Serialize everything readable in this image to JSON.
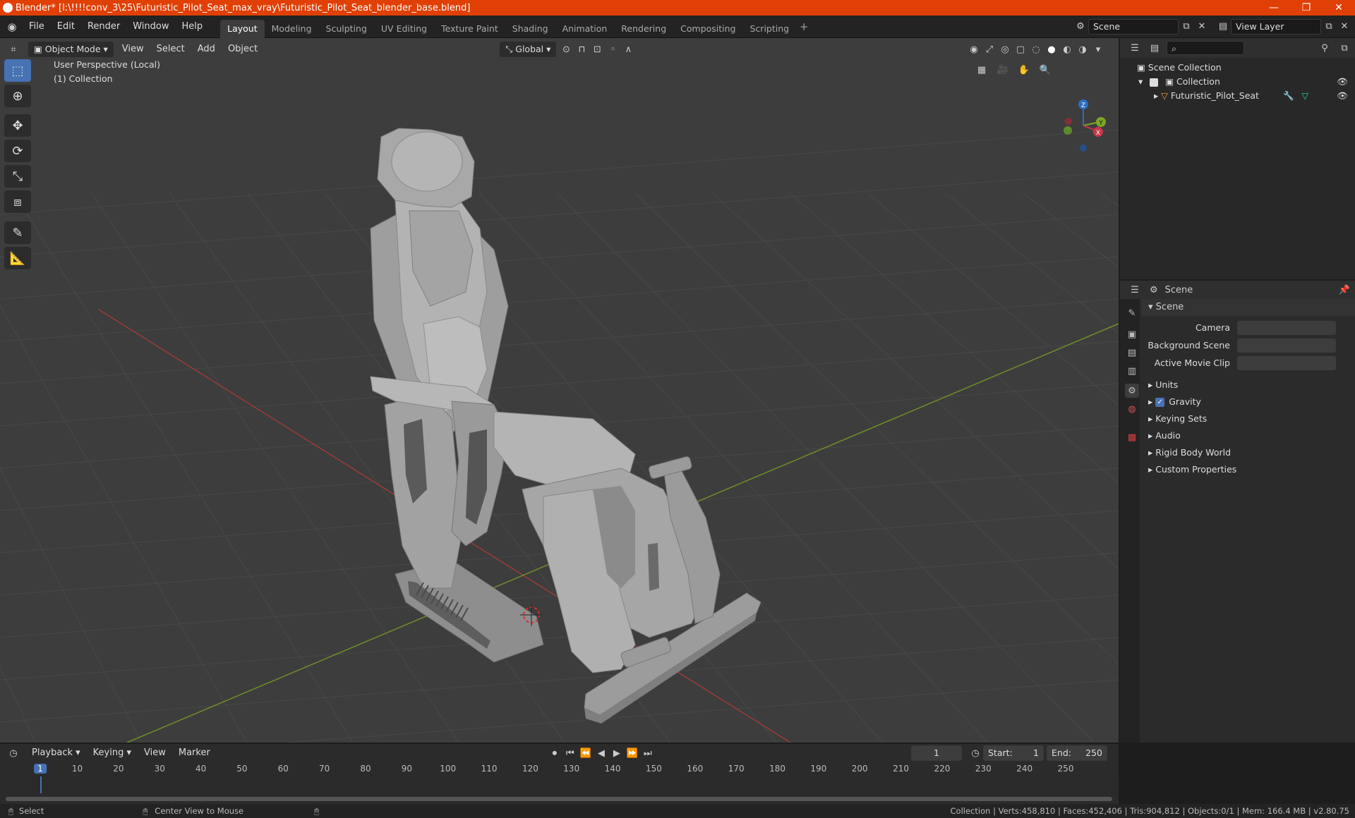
{
  "window": {
    "title": "Blender* [I:\\!!!!conv_3\\25\\Futuristic_Pilot_Seat_max_vray\\Futuristic_Pilot_Seat_blender_base.blend]",
    "minimize": "—",
    "maximize": "❐",
    "close": "✕"
  },
  "menu": [
    "File",
    "Edit",
    "Render",
    "Window",
    "Help"
  ],
  "workspaces": [
    "Layout",
    "Modeling",
    "Sculpting",
    "UV Editing",
    "Texture Paint",
    "Shading",
    "Animation",
    "Rendering",
    "Compositing",
    "Scripting"
  ],
  "active_workspace": "Layout",
  "scene_field": "Scene",
  "view_layer_field": "View Layer",
  "viewport": {
    "mode": "Object Mode",
    "menu": [
      "View",
      "Select",
      "Add",
      "Object"
    ],
    "transform_orientation": "Global",
    "overlay_line1": "User Perspective (Local)",
    "overlay_line2": "(1) Collection",
    "gizmo_axes": {
      "z": "Z",
      "y": "Y",
      "x": "X"
    },
    "colors": {
      "background": "#3d3d3d",
      "grid": "#484848",
      "x_axis": "#9b3b3b",
      "y_axis": "#6f8e2a",
      "mesh": "#a9a9a9"
    }
  },
  "tools": [
    "select-box",
    "cursor",
    "move",
    "rotate",
    "scale",
    "transform",
    "annotate",
    "measure"
  ],
  "outliner": {
    "root": "Scene Collection",
    "collection": "Collection",
    "object": "Futuristic_Pilot_Seat"
  },
  "properties": {
    "context": "Scene",
    "panel": "Scene",
    "camera_label": "Camera",
    "background_scene_label": "Background Scene",
    "active_movie_clip_label": "Active Movie Clip",
    "sections": [
      "Units",
      "Gravity",
      "Keying Sets",
      "Audio",
      "Rigid Body World",
      "Custom Properties"
    ],
    "gravity_checked": true
  },
  "timeline": {
    "menu": [
      "Playback",
      "Keying",
      "View",
      "Marker"
    ],
    "current_frame": "1",
    "start_label": "Start:",
    "start": "1",
    "end_label": "End:",
    "end": "250",
    "ruler": [
      "1",
      "10",
      "20",
      "30",
      "40",
      "50",
      "60",
      "70",
      "80",
      "90",
      "100",
      "110",
      "120",
      "130",
      "140",
      "150",
      "160",
      "170",
      "180",
      "190",
      "200",
      "210",
      "220",
      "230",
      "240",
      "250"
    ]
  },
  "status": {
    "select": "Select",
    "center": "Center View to Mouse",
    "stats": "Collection | Verts:458,810 | Faces:452,406 | Tris:904,812 | Objects:0/1 | Mem: 166.4 MB | v2.80.75"
  }
}
